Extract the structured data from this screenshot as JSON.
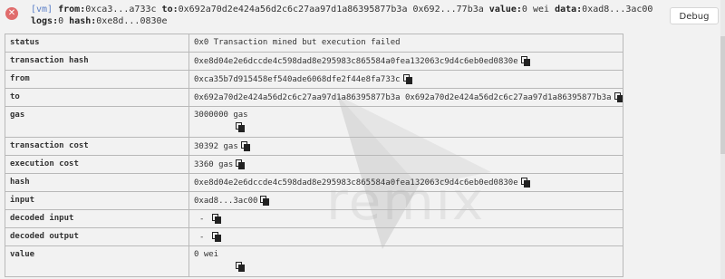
{
  "header": {
    "tag": "[vm]",
    "from_label": "from:",
    "from_value": "0xca3...a733c",
    "to_label": "to:",
    "to_value": "0x692a70d2e424a56d2c6c27aa97d1a86395877b3a 0x692...77b3a",
    "value_label": "value:",
    "value_value": "0 wei",
    "data_label": "data:",
    "data_value": "0xad8...3ac00",
    "logs_label": "logs:",
    "logs_value": "0",
    "hash_label": "hash:",
    "hash_value": "0xe8d...0830e",
    "debug_label": "Debug",
    "status_icon": "error-x-icon"
  },
  "watermark": "remix",
  "rows": {
    "status": {
      "key": "status",
      "value": "0x0 Transaction mined but execution failed"
    },
    "transaction_hash": {
      "key": "transaction hash",
      "value": "0xe8d04e2e6dccde4c598dad8e295983c865584a0fea132063c9d4c6eb0ed0830e"
    },
    "from": {
      "key": "from",
      "value": "0xca35b7d915458ef540ade6068dfe2f44e8fa733c"
    },
    "to": {
      "key": "to",
      "value": "0x692a70d2e424a56d2c6c27aa97d1a86395877b3a 0x692a70d2e424a56d2c6c27aa97d1a86395877b3a"
    },
    "gas": {
      "key": "gas",
      "value": "3000000 gas"
    },
    "transaction_cost": {
      "key": "transaction cost",
      "value": "30392 gas"
    },
    "execution_cost": {
      "key": "execution cost",
      "value": "3360 gas"
    },
    "hash": {
      "key": "hash",
      "value": "0xe8d04e2e6dccde4c598dad8e295983c865584a0fea132063c9d4c6eb0ed0830e"
    },
    "input": {
      "key": "input",
      "value": "0xad8...3ac00"
    },
    "decoded_input": {
      "key": "decoded input",
      "value": "-"
    },
    "decoded_output": {
      "key": "decoded output",
      "value": "-"
    },
    "value": {
      "key": "value",
      "value": "0 wei"
    }
  },
  "colors": {
    "background": "#f2f2f2",
    "border": "#b9b9b9",
    "error": "#e06c6c",
    "tag": "#5b7fc7"
  },
  "icons": {
    "copy": "copy-icon"
  }
}
